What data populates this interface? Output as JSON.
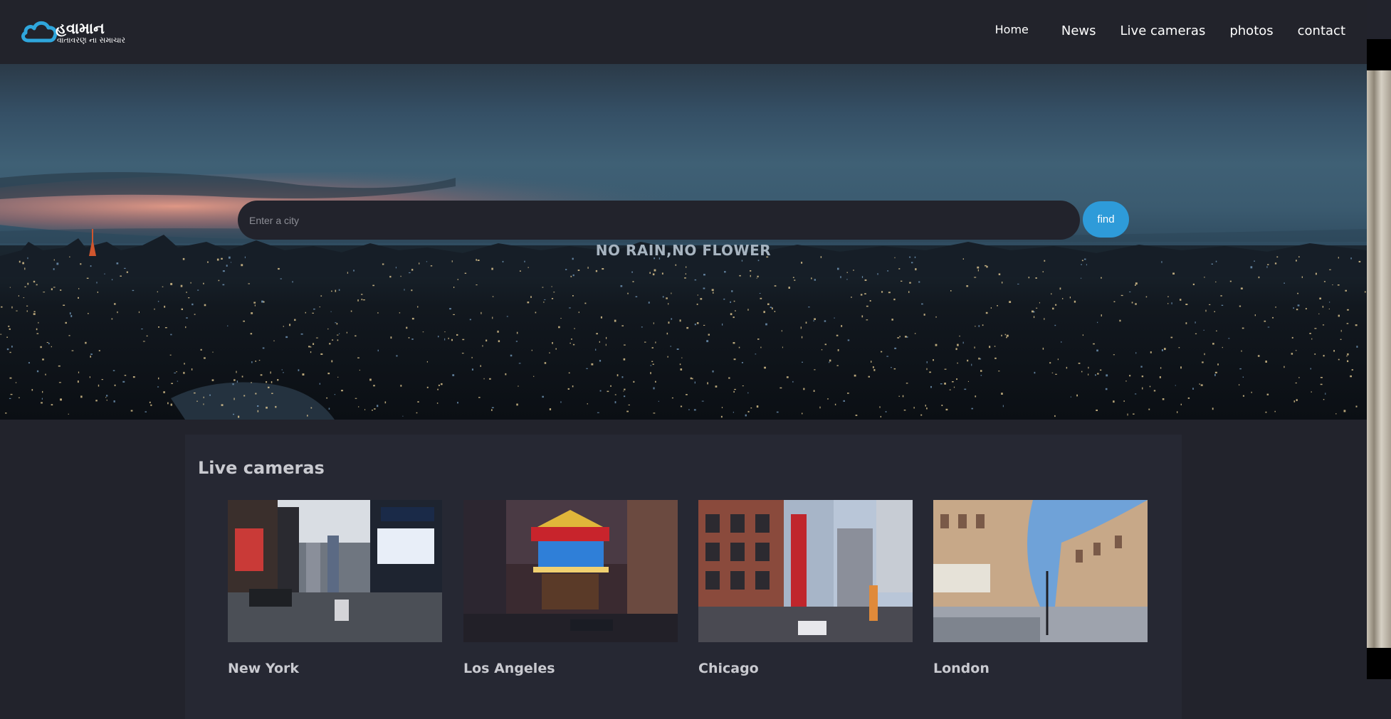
{
  "header": {
    "logo_title": "હવામાન",
    "logo_subtitle": "વાતાવરણ ના સમાચાર",
    "nav": [
      "Home",
      "News",
      "Live cameras",
      "photos",
      "contact"
    ]
  },
  "hero": {
    "search_placeholder": "Enter a city",
    "find_label": "find",
    "tagline": "NO RAIN,NO FLOWER"
  },
  "live_cameras": {
    "title": "Live cameras",
    "cities": [
      "New York",
      "Los Angeles",
      "Chicago",
      "London"
    ]
  },
  "colors": {
    "background": "#22232c",
    "accent": "#2e9bd9",
    "panel": "#262833"
  }
}
